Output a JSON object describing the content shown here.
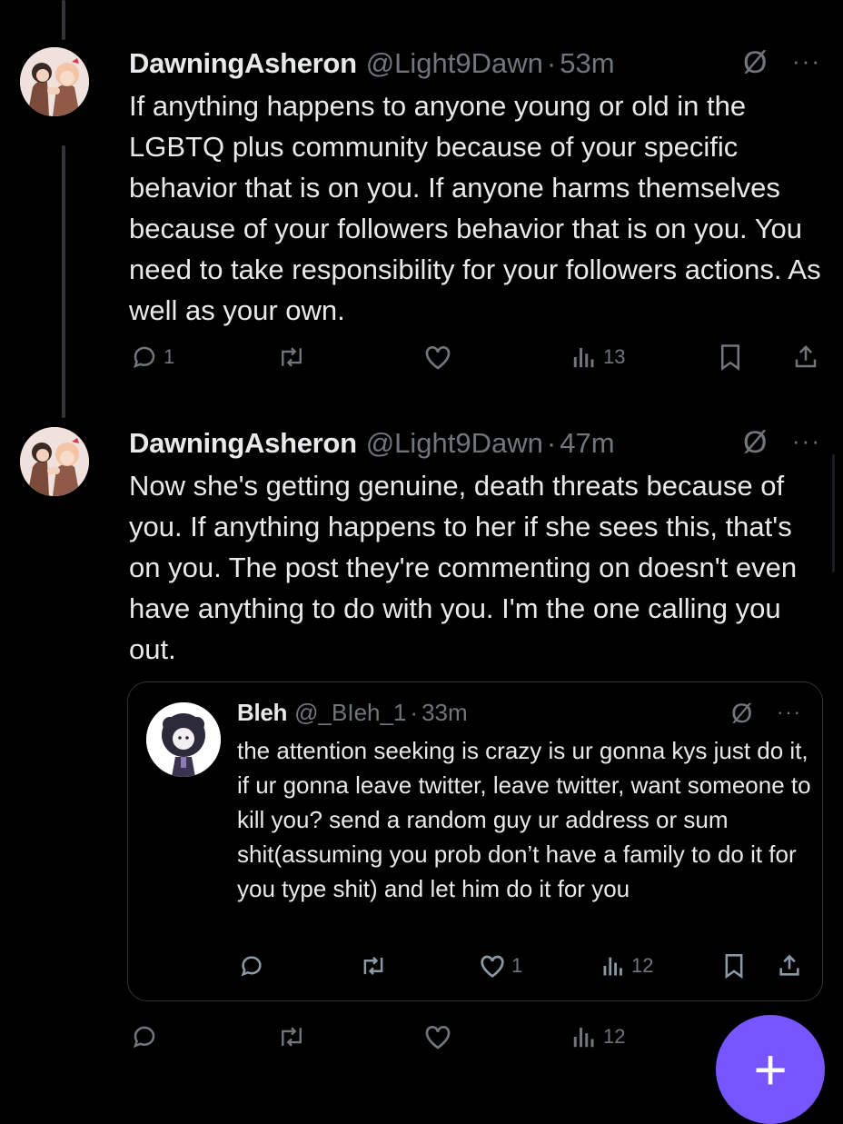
{
  "tweets": [
    {
      "display_name": "DawningAsheron",
      "handle": "@Light9Dawn",
      "separator": "·",
      "time": "53m",
      "text": "If anything happens to anyone young or old in the LGBTQ plus community because of your specific behavior that is on you. If anyone harms themselves because of your followers behavior that is on you. You need to take responsibility for your followers actions. As well as your own.",
      "reply_count": "1",
      "views": "13"
    },
    {
      "display_name": "DawningAsheron",
      "handle": "@Light9Dawn",
      "separator": "·",
      "time": "47m",
      "text": "Now she's getting genuine, death threats because of you. If anything happens to her if she sees this, that's on you. The post they're commenting on doesn't even have anything to do with you. I'm the one calling you out.",
      "views": "12"
    }
  ],
  "quote": {
    "display_name": "Bleh",
    "handle": "@_BIeh_1",
    "separator": "·",
    "time": "33m",
    "text": "the attention seeking is crazy is ur gonna kys just do it, if ur gonna leave twitter, leave twitter, want someone to kill you? send a random guy ur address or sum shit(assuming you prob don’t have a family to do it for you type shit) and let him do it for you",
    "like_count": "1",
    "views": "12"
  },
  "more_symbol": "···",
  "grok_symbol": "Ø",
  "fab_symbol": "+",
  "colors": {
    "accent": "#7856ff",
    "muted": "#71767b",
    "text": "#e7e9ea",
    "background": "#000000"
  }
}
